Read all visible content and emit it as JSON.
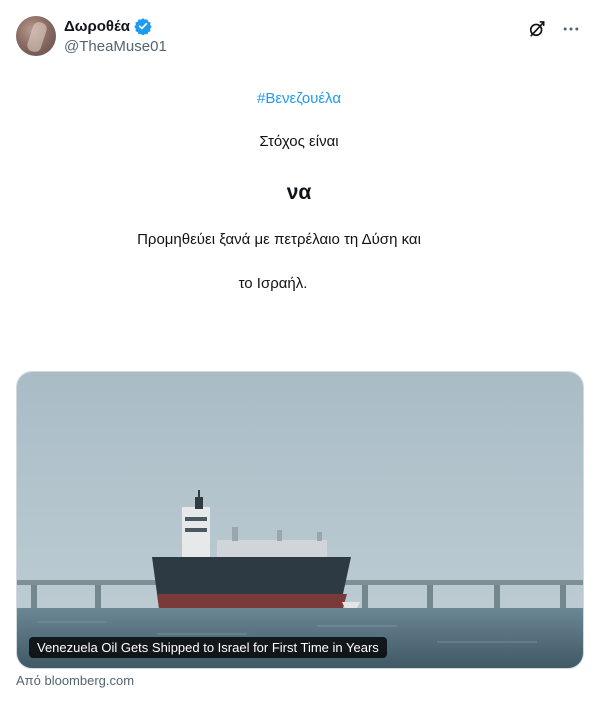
{
  "post": {
    "author": {
      "display_name": "Δωροθέα",
      "handle": "@TheaMuse01",
      "verified": true
    },
    "lines": {
      "hashtag": "#Βενεζουέλα",
      "line1": "Στόχος είναι",
      "line2": "να",
      "line3": "Προμηθεύει ξανά με πετρέλαιο τη Δύση και",
      "line4": "το Ισραήλ."
    },
    "link_card": {
      "headline": "Venezuela Oil Gets Shipped to Israel for First Time in Years",
      "source_text": "Από bloomberg.com"
    }
  },
  "icons": {
    "verified": "verified-badge-icon",
    "grok": "grok-icon",
    "more": "more-options-icon"
  },
  "colors": {
    "accent": "#1d9bf0",
    "secondary_text": "#536471"
  }
}
